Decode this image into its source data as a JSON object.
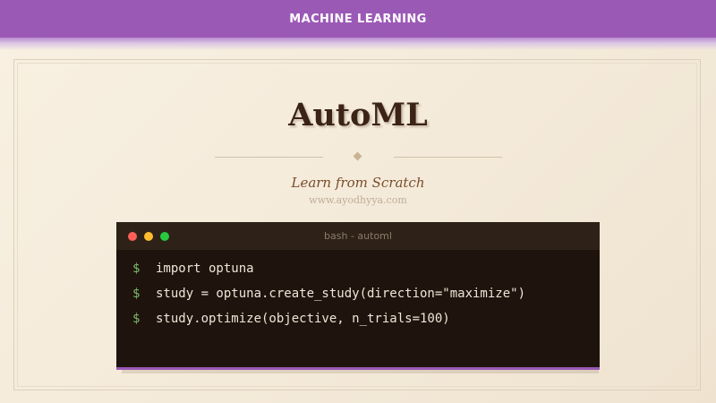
{
  "header": {
    "category": "MACHINE LEARNING"
  },
  "slide": {
    "title": "AutoML",
    "subtitle": "Learn from Scratch",
    "website": "www.ayodhyya.com"
  },
  "terminal": {
    "title": "bash - automl",
    "prompt_symbol": "$",
    "lines": [
      "import optuna",
      "study = optuna.create_study(direction=\"maximize\")",
      "study.optimize(objective, n_trials=100)"
    ]
  },
  "colors": {
    "accent": "#9b59b6",
    "background": "#f4ead9",
    "terminal_bg": "#1e130d",
    "prompt": "#7dbb6a",
    "title": "#3b2416"
  }
}
